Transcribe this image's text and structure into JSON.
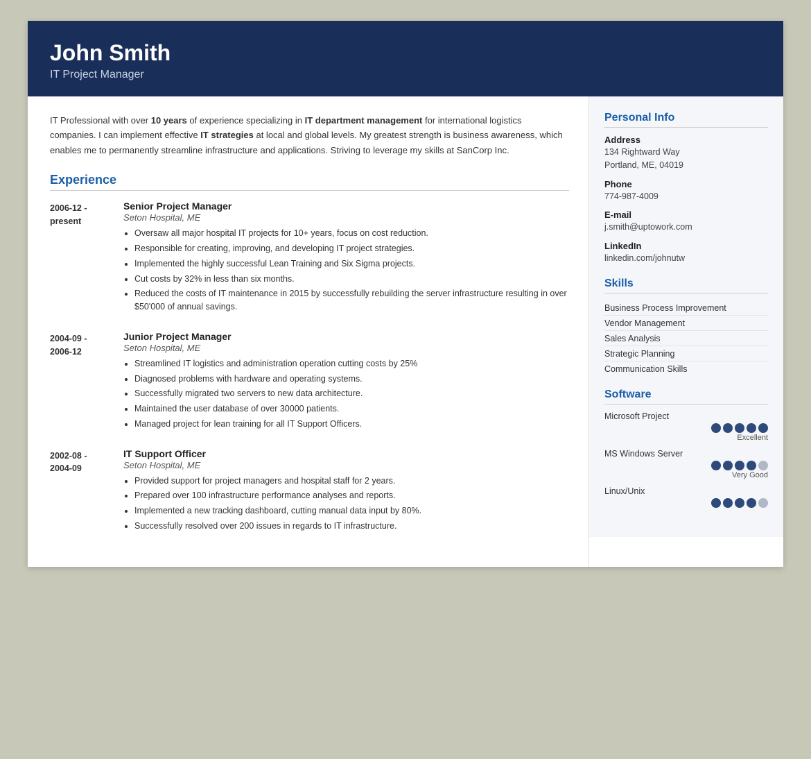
{
  "header": {
    "name": "John Smith",
    "title": "IT Project Manager"
  },
  "summary": "IT Professional with over <b>10 years</b> of experience specializing in <b>IT department management</b> for international logistics companies. I can implement effective <b>IT strategies</b> at local and global levels. My greatest strength is business awareness, which enables me to permanently streamline infrastructure and applications. Striving to leverage my skills at SanCorp Inc.",
  "experience_title": "Experience",
  "experiences": [
    {
      "dates": "2006-12 - present",
      "title": "Senior Project Manager",
      "company": "Seton Hospital, ME",
      "bullets": [
        "Oversaw all major hospital IT projects for 10+ years, focus on cost reduction.",
        "Responsible for creating, improving, and developing IT project strategies.",
        "Implemented the highly successful Lean Training and Six Sigma projects.",
        "Cut costs by 32% in less than six months.",
        "Reduced the costs of IT maintenance in 2015 by successfully rebuilding the server infrastructure resulting in over $50'000 of annual savings."
      ]
    },
    {
      "dates": "2004-09 - 2006-12",
      "title": "Junior Project Manager",
      "company": "Seton Hospital, ME",
      "bullets": [
        "Streamlined IT logistics and administration operation cutting costs by 25%",
        "Diagnosed problems with hardware and operating systems.",
        "Successfully migrated two servers to new data architecture.",
        "Maintained the user database of over 30000 patients.",
        "Managed project for lean training for all IT Support Officers."
      ]
    },
    {
      "dates": "2002-08 - 2004-09",
      "title": "IT Support Officer",
      "company": "Seton Hospital, ME",
      "bullets": [
        "Provided support for project managers and hospital staff for 2 years.",
        "Prepared over 100 infrastructure performance analyses and reports.",
        "Implemented a new tracking dashboard, cutting manual data input by 80%.",
        "Successfully resolved over 200 issues in regards to IT infrastructure."
      ]
    }
  ],
  "personal_info_title": "Personal Info",
  "personal_info": {
    "address_label": "Address",
    "address_value": "134 Rightward Way\nPortland, ME, 04019",
    "phone_label": "Phone",
    "phone_value": "774-987-4009",
    "email_label": "E-mail",
    "email_value": "j.smith@uptowork.com",
    "linkedin_label": "LinkedIn",
    "linkedin_value": "linkedin.com/johnutw"
  },
  "skills_title": "Skills",
  "skills": [
    "Business Process Improvement",
    "Vendor Management",
    "Sales Analysis",
    "Strategic Planning",
    "Communication Skills"
  ],
  "software_title": "Software",
  "software": [
    {
      "name": "Microsoft Project",
      "filled": 5,
      "total": 5,
      "label": "Excellent"
    },
    {
      "name": "MS Windows Server",
      "filled": 4,
      "total": 5,
      "label": "Very Good"
    },
    {
      "name": "Linux/Unix",
      "filled": 4,
      "total": 5,
      "label": ""
    }
  ]
}
